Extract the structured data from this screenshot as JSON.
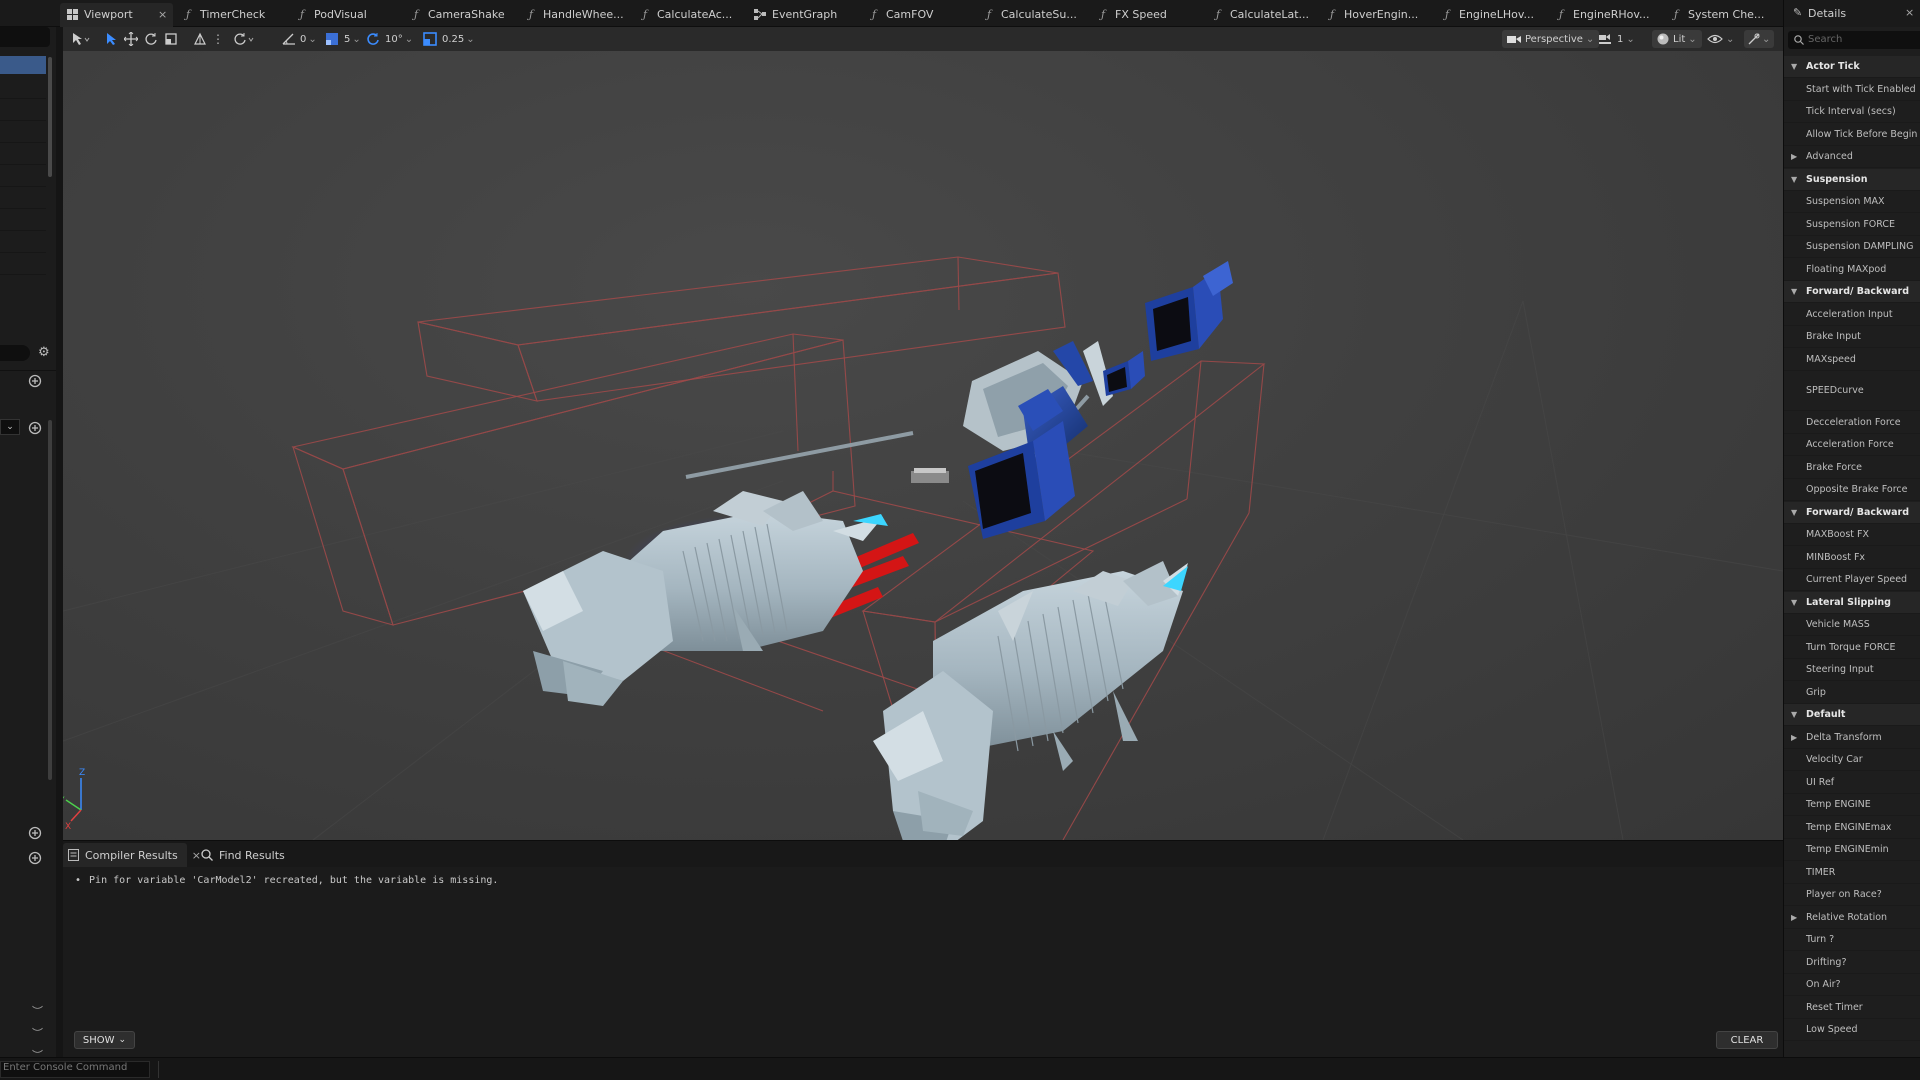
{
  "tabs": [
    {
      "label": "Viewport",
      "icon": "grid-icon"
    },
    {
      "label": "TimerCheck",
      "icon": "function-icon"
    },
    {
      "label": "PodVisual",
      "icon": "function-icon"
    },
    {
      "label": "CameraShake",
      "icon": "function-icon"
    },
    {
      "label": "HandleWhee...",
      "icon": "function-icon"
    },
    {
      "label": "CalculateAc...",
      "icon": "function-icon"
    },
    {
      "label": "EventGraph",
      "icon": "graph-icon"
    },
    {
      "label": "CamFOV",
      "icon": "function-icon"
    },
    {
      "label": "CalculateSu...",
      "icon": "function-icon"
    },
    {
      "label": "FX Speed",
      "icon": "function-icon"
    },
    {
      "label": "CalculateLat...",
      "icon": "function-icon"
    },
    {
      "label": "HoverEngin...",
      "icon": "function-icon"
    },
    {
      "label": "EngineLHov...",
      "icon": "function-icon"
    },
    {
      "label": "EngineRHov...",
      "icon": "function-icon"
    },
    {
      "label": "System Che...",
      "icon": "function-icon"
    }
  ],
  "toolbar": {
    "angle_snap_value": "0",
    "grid_snap_value": "5",
    "rotation_snap_value": "10°",
    "scale_snap_value": "0.25",
    "perspective_label": "Perspective",
    "camera_speed": "1",
    "lit_label": "Lit"
  },
  "compiler": {
    "tab_results": "Compiler Results",
    "tab_find": "Find Results",
    "message": "Pin for variable 'CarModel2' recreated, but the variable is missing.",
    "show_label": "SHOW",
    "clear_label": "CLEAR"
  },
  "details": {
    "title": "Details",
    "search_placeholder": "Search",
    "rows": [
      {
        "label": "Actor Tick",
        "type": "category"
      },
      {
        "label": "Start with Tick Enabled",
        "type": "prop"
      },
      {
        "label": "Tick Interval (secs)",
        "type": "prop"
      },
      {
        "label": "Allow Tick Before Begin Play",
        "type": "prop"
      },
      {
        "label": "Advanced",
        "type": "expander"
      },
      {
        "label": "Suspension",
        "type": "category"
      },
      {
        "label": "Suspension MAX",
        "type": "prop"
      },
      {
        "label": "Suspension FORCE",
        "type": "prop"
      },
      {
        "label": "Suspension DAMPLING",
        "type": "prop"
      },
      {
        "label": "Floating MAXpod",
        "type": "prop"
      },
      {
        "label": "Forward/ Backward",
        "type": "category"
      },
      {
        "label": "Acceleration Input",
        "type": "prop"
      },
      {
        "label": "Brake Input",
        "type": "prop"
      },
      {
        "label": "MAXspeed",
        "type": "prop"
      },
      {
        "label": "SPEEDcurve",
        "type": "prop-tall"
      },
      {
        "label": "Decceleration Force",
        "type": "prop"
      },
      {
        "label": "Acceleration Force",
        "type": "prop"
      },
      {
        "label": "Brake Force",
        "type": "prop"
      },
      {
        "label": "Opposite Brake Force",
        "type": "prop"
      },
      {
        "label": "Forward/ Backward",
        "type": "category"
      },
      {
        "label": "MAXBoost FX",
        "type": "prop"
      },
      {
        "label": "MINBoost Fx",
        "type": "prop"
      },
      {
        "label": "Current Player Speed",
        "type": "prop"
      },
      {
        "label": "Lateral Slipping",
        "type": "category"
      },
      {
        "label": "Vehicle MASS",
        "type": "prop"
      },
      {
        "label": "Turn Torque FORCE",
        "type": "prop"
      },
      {
        "label": "Steering Input",
        "type": "prop"
      },
      {
        "label": "Grip",
        "type": "prop"
      },
      {
        "label": "Default",
        "type": "category"
      },
      {
        "label": "Delta Transform",
        "type": "expander"
      },
      {
        "label": "Velocity Car",
        "type": "prop"
      },
      {
        "label": "UI Ref",
        "type": "prop"
      },
      {
        "label": "Temp ENGINE",
        "type": "prop"
      },
      {
        "label": "Temp ENGINEmax",
        "type": "prop"
      },
      {
        "label": "Temp ENGINEmin",
        "type": "prop"
      },
      {
        "label": "TIMER",
        "type": "prop"
      },
      {
        "label": "Player on Race?",
        "type": "prop"
      },
      {
        "label": "Relative Rotation",
        "type": "expander"
      },
      {
        "label": "Turn ?",
        "type": "prop"
      },
      {
        "label": "Drifting?",
        "type": "prop"
      },
      {
        "label": "On Air?",
        "type": "prop"
      },
      {
        "label": "Reset Timer",
        "type": "prop"
      },
      {
        "label": "Low Speed",
        "type": "prop"
      }
    ]
  },
  "statusbar": {
    "command_placeholder": "Enter Console Command"
  },
  "axis": {
    "x": "X",
    "y": "Y",
    "z": "Z"
  },
  "colors": {
    "accent_blue": "#3b6fd6",
    "bound_box": "#a34444",
    "engine_body": "#a9bcc6",
    "pod_blue": "#1e3f9e",
    "selection_highlight": "#3a5a8a"
  }
}
